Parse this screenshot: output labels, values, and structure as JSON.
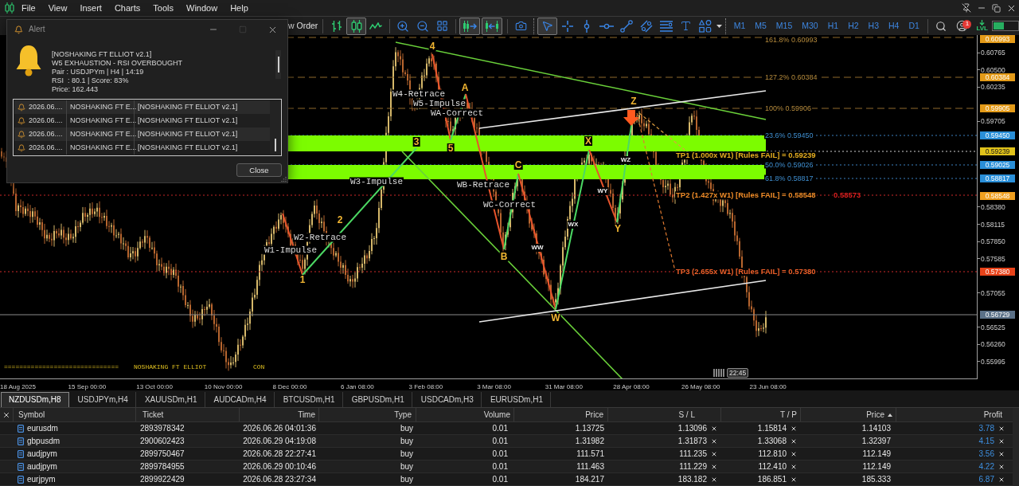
{
  "menu": [
    "File",
    "View",
    "Insert",
    "Charts",
    "Tools",
    "Window",
    "Help"
  ],
  "toolbar": {
    "order_button": "w Order",
    "chart_types": [
      {
        "kind": "bars",
        "selected": false
      },
      {
        "kind": "candles",
        "selected": true
      },
      {
        "kind": "line",
        "selected": false
      }
    ],
    "chart_toggles": [
      {
        "kind": "autoscroll",
        "on": true
      },
      {
        "kind": "shift",
        "on": true
      }
    ],
    "tools": [
      {
        "kind": "cursor",
        "selected": true
      },
      {
        "kind": "crosshair",
        "selected": false
      },
      {
        "kind": "vertical_line",
        "selected": false
      },
      {
        "kind": "horizontal_line",
        "selected": false
      },
      {
        "kind": "trend_line",
        "selected": false
      },
      {
        "kind": "channel",
        "selected": false
      },
      {
        "kind": "fibonacci",
        "selected": false
      },
      {
        "kind": "text",
        "selected": false
      },
      {
        "kind": "shapes",
        "selected": false
      }
    ],
    "timeframes": [
      {
        "label": "M1",
        "selected": false
      },
      {
        "label": "M5",
        "selected": false
      },
      {
        "label": "M15",
        "selected": false
      },
      {
        "label": "M30",
        "selected": false
      },
      {
        "label": "H1",
        "selected": false
      },
      {
        "label": "H2",
        "selected": false
      },
      {
        "label": "H3",
        "selected": false
      },
      {
        "label": "H4",
        "selected": false
      },
      {
        "label": "D1",
        "selected": false
      }
    ],
    "notification_count": "1",
    "levels_label": "LVL"
  },
  "alert": {
    "title": "Alert",
    "window_buttons": [
      {
        "kind": "minimize",
        "disabled": false
      },
      {
        "kind": "maximize",
        "disabled": true
      },
      {
        "kind": "close",
        "disabled": false
      }
    ],
    "message": [
      "[NOSHAKING FT ELLIOT v2.1]",
      "W5 EXHAUSTION - RSI OVERBOUGHT",
      "Pair : USDJPYm | H4 | 14:19",
      "RSI  : 80.1 | Score: 83%",
      "Price: 162.443"
    ],
    "history": [
      {
        "time": "2026.06....",
        "source": "NOSHAKING FT E...",
        "message": "[NOSHAKING FT ELLIOT v2.1]"
      },
      {
        "time": "2026.06....",
        "source": "NOSHAKING FT E...",
        "message": "[NOSHAKING FT ELLIOT v2.1]"
      },
      {
        "time": "2026.06....",
        "source": "NOSHAKING FT E...",
        "message": "[NOSHAKING FT ELLIOT v2.1]"
      },
      {
        "time": "2026.06....",
        "source": "NOSHAKING FT E...",
        "message": "[NOSHAKING FT ELLIOT v2.1]"
      }
    ],
    "close_button": "Close"
  },
  "chart": {
    "fib_levels": [
      {
        "label": "161.8% 0.60993",
        "kind": "extension"
      },
      {
        "label": "127.2% 0.60384",
        "kind": "extension"
      },
      {
        "label": "100% 0.59906",
        "kind": "extension"
      },
      {
        "label": "23.6% 0.59450",
        "kind": "retracement"
      },
      {
        "label": "50.0% 0.59026",
        "kind": "retracement"
      },
      {
        "label": "61.8% 0.58817",
        "kind": "retracement"
      }
    ],
    "targets": [
      {
        "label": "TP1 (1.000x W1) [Rules FAIL] = 0.59239",
        "color": "#e8b020"
      },
      {
        "label": "TP2 (1.427x W1) [Rules FAIL] = 0.58548",
        "color": "#f08c28"
      },
      {
        "label": "TP3 (2.655x W1) [Rules FAIL] = 0.57380",
        "color": "#f0602a"
      }
    ],
    "secondary_level_label": "0.58573",
    "wave_points": [
      "1",
      "2",
      "3",
      "4",
      "5",
      "A",
      "B",
      "C",
      "W",
      "X",
      "Y",
      "Z"
    ],
    "sub_waves": [
      "WW",
      "WX",
      "WY",
      "WZ"
    ],
    "wave_notes": [
      "W1-Impulse",
      "W2-Retrace",
      "W3-Impulse",
      "W4-Retrace",
      "W5-Impulse",
      "WA-Correct",
      "WB-Retrace",
      "WC-Correct"
    ],
    "signature": [
      "==============================",
      "NOSHAKING FT ELLIOT",
      "CON"
    ],
    "countdown": "22:45"
  },
  "price_axis": {
    "ticks": [
      "0.60765",
      "0.60500",
      "0.60235",
      "0.59705",
      "0.58380",
      "0.58115",
      "0.57850",
      "0.57585",
      "0.57055",
      "0.56525",
      "0.56260",
      "0.55995"
    ],
    "markers": [
      {
        "value": "0.60993",
        "color": "#e39a18"
      },
      {
        "value": "0.60384",
        "color": "#e39a18"
      },
      {
        "value": "0.59905",
        "color": "#e39a18"
      },
      {
        "value": "0.59450",
        "color": "#2a8fd8"
      },
      {
        "value": "0.59239",
        "color": "#e0c21a"
      },
      {
        "value": "0.59025",
        "color": "#2a8fd8"
      },
      {
        "value": "0.58817",
        "color": "#2a8fd8"
      },
      {
        "value": "0.58548",
        "color": "#f0a020"
      },
      {
        "value": "0.57380",
        "color": "#e8431a"
      },
      {
        "value": "0.56729",
        "color": "#5b7188"
      }
    ]
  },
  "time_axis": [
    "18 Aug 2025",
    "15 Sep 00:00",
    "13 Oct 00:00",
    "10 Nov 00:00",
    "8 Dec 00:00",
    "6 Jan 08:00",
    "3 Feb 08:00",
    "3 Mar 08:00",
    "31 Mar 08:00",
    "28 Apr 08:00",
    "26 May 08:00",
    "23 Jun 08:00"
  ],
  "symbol_tabs": [
    {
      "label": "NZDUSDm,H8",
      "selected": true
    },
    {
      "label": "USDJPYm,H4",
      "selected": false
    },
    {
      "label": "XAUUSDm,H1",
      "selected": false
    },
    {
      "label": "AUDCADm,H4",
      "selected": false
    },
    {
      "label": "BTCUSDm,H1",
      "selected": false
    },
    {
      "label": "GBPUSDm,H1",
      "selected": false
    },
    {
      "label": "USDCADm,H3",
      "selected": false
    },
    {
      "label": "EURUSDm,H1",
      "selected": false
    }
  ],
  "positions": {
    "columns": [
      {
        "label": "Symbol",
        "sorted": false
      },
      {
        "label": "Ticket",
        "sorted": false
      },
      {
        "label": "Time",
        "sorted": false
      },
      {
        "label": "Type",
        "sorted": false
      },
      {
        "label": "Volume",
        "sorted": false
      },
      {
        "label": "Price",
        "sorted": false
      },
      {
        "label": "S / L",
        "sorted": false
      },
      {
        "label": "T / P",
        "sorted": false
      },
      {
        "label": "Price",
        "sorted": true
      },
      {
        "label": "Profit",
        "sorted": false
      }
    ],
    "rows": [
      {
        "symbol": "eurusdm",
        "ticket": "2893978342",
        "time": "2026.06.26 04:01:36",
        "type": "buy",
        "volume": "0.01",
        "price": "1.13725",
        "sl": "1.13096",
        "tp": "1.15814",
        "current_price": "1.14103",
        "profit": "3.78"
      },
      {
        "symbol": "gbpusdm",
        "ticket": "2900602423",
        "time": "2026.06.29 04:19:08",
        "type": "buy",
        "volume": "0.01",
        "price": "1.31982",
        "sl": "1.31873",
        "tp": "1.33068",
        "current_price": "1.32397",
        "profit": "4.15"
      },
      {
        "symbol": "audjpym",
        "ticket": "2899750467",
        "time": "2026.06.28 22:27:41",
        "type": "buy",
        "volume": "0.01",
        "price": "111.571",
        "sl": "111.235",
        "tp": "112.810",
        "current_price": "112.149",
        "profit": "3.56"
      },
      {
        "symbol": "audjpym",
        "ticket": "2899784955",
        "time": "2026.06.29 00:10:46",
        "type": "buy",
        "volume": "0.01",
        "price": "111.463",
        "sl": "111.229",
        "tp": "112.410",
        "current_price": "112.149",
        "profit": "4.22"
      },
      {
        "symbol": "eurjpym",
        "ticket": "2899922429",
        "time": "2026.06.28 23:27:34",
        "type": "buy",
        "volume": "0.01",
        "price": "184.217",
        "sl": "183.182",
        "tp": "186.851",
        "current_price": "185.333",
        "profit": "6.87"
      }
    ]
  }
}
